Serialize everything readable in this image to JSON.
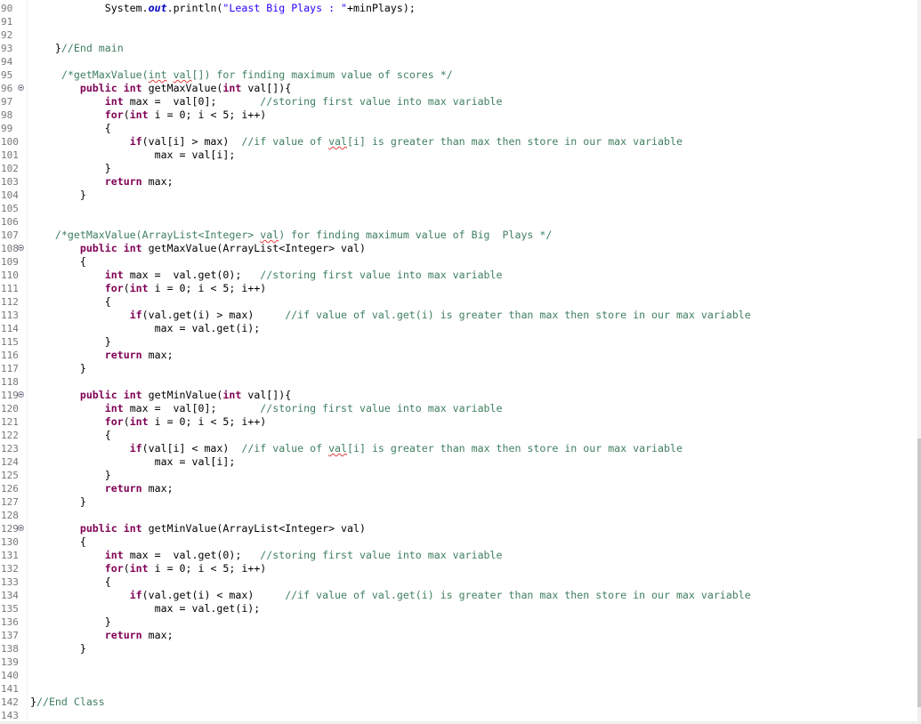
{
  "editor": {
    "language": "java",
    "colors": {
      "keyword": "#7f0055",
      "comment": "#3f7f5f",
      "string": "#2a00ff",
      "static_field": "#0000c0",
      "line_number": "#787878"
    },
    "lines": [
      {
        "n": "90",
        "fold": false,
        "tokens": [
          [
            "",
            "            "
          ],
          [
            "",
            "System."
          ],
          [
            "fld",
            "out"
          ],
          [
            "",
            ".println("
          ],
          [
            "str",
            "\"Least Big Plays : \""
          ],
          [
            "",
            "+minPlays);"
          ]
        ]
      },
      {
        "n": "91",
        "fold": false,
        "tokens": []
      },
      {
        "n": "92",
        "fold": false,
        "tokens": []
      },
      {
        "n": "93",
        "fold": false,
        "tokens": [
          [
            "",
            "    }"
          ],
          [
            "cm",
            "//End main"
          ]
        ]
      },
      {
        "n": "94",
        "fold": false,
        "tokens": []
      },
      {
        "n": "95",
        "fold": false,
        "tokens": [
          [
            "cm",
            "     /*getMaxValue("
          ],
          [
            "cm sq",
            "int"
          ],
          [
            "cm",
            " "
          ],
          [
            "cm sq",
            "val"
          ],
          [
            "cm",
            "[]) for finding maximum value of scores */"
          ]
        ]
      },
      {
        "n": "96",
        "fold": true,
        "tokens": [
          [
            "",
            "        "
          ],
          [
            "kw",
            "public"
          ],
          [
            "",
            " "
          ],
          [
            "kw",
            "int"
          ],
          [
            "",
            " getMaxValue("
          ],
          [
            "kw",
            "int"
          ],
          [
            "",
            " val[]){"
          ]
        ]
      },
      {
        "n": "97",
        "fold": false,
        "tokens": [
          [
            "",
            "            "
          ],
          [
            "kw",
            "int"
          ],
          [
            "",
            " max =  val[0];       "
          ],
          [
            "cm",
            "//storing first value into max variable"
          ]
        ]
      },
      {
        "n": "98",
        "fold": false,
        "tokens": [
          [
            "",
            "            "
          ],
          [
            "kw",
            "for"
          ],
          [
            "",
            "("
          ],
          [
            "kw",
            "int"
          ],
          [
            "",
            " i = 0; i < 5; i++)"
          ]
        ]
      },
      {
        "n": "99",
        "fold": false,
        "tokens": [
          [
            "",
            "            {"
          ]
        ]
      },
      {
        "n": "100",
        "fold": false,
        "tokens": [
          [
            "",
            "                "
          ],
          [
            "kw",
            "if"
          ],
          [
            "",
            "(val[i] > max)  "
          ],
          [
            "cm",
            "//if value of "
          ],
          [
            "cm sq",
            "val"
          ],
          [
            "cm",
            "[i] is greater than max then store in our max variable"
          ]
        ]
      },
      {
        "n": "101",
        "fold": false,
        "tokens": [
          [
            "",
            "                    max = val[i];"
          ]
        ]
      },
      {
        "n": "102",
        "fold": false,
        "tokens": [
          [
            "",
            "            }"
          ]
        ]
      },
      {
        "n": "103",
        "fold": false,
        "tokens": [
          [
            "",
            "            "
          ],
          [
            "kw",
            "return"
          ],
          [
            "",
            " max;"
          ]
        ]
      },
      {
        "n": "104",
        "fold": false,
        "tokens": [
          [
            "",
            "        }"
          ]
        ]
      },
      {
        "n": "105",
        "fold": false,
        "tokens": []
      },
      {
        "n": "106",
        "fold": false,
        "tokens": []
      },
      {
        "n": "107",
        "fold": false,
        "tokens": [
          [
            "cm",
            "    /*getMaxValue(ArrayList<Integer> "
          ],
          [
            "cm sq",
            "val"
          ],
          [
            "cm",
            ") for finding maximum value of Big  Plays */"
          ]
        ]
      },
      {
        "n": "108",
        "fold": true,
        "tokens": [
          [
            "",
            "        "
          ],
          [
            "kw",
            "public"
          ],
          [
            "",
            " "
          ],
          [
            "kw",
            "int"
          ],
          [
            "",
            " getMaxValue(ArrayList<Integer> val)"
          ]
        ]
      },
      {
        "n": "109",
        "fold": false,
        "tokens": [
          [
            "",
            "        {"
          ]
        ]
      },
      {
        "n": "110",
        "fold": false,
        "tokens": [
          [
            "",
            "            "
          ],
          [
            "kw",
            "int"
          ],
          [
            "",
            " max =  val.get(0);   "
          ],
          [
            "cm",
            "//storing first value into max variable"
          ]
        ]
      },
      {
        "n": "111",
        "fold": false,
        "tokens": [
          [
            "",
            "            "
          ],
          [
            "kw",
            "for"
          ],
          [
            "",
            "("
          ],
          [
            "kw",
            "int"
          ],
          [
            "",
            " i = 0; i < 5; i++)"
          ]
        ]
      },
      {
        "n": "112",
        "fold": false,
        "tokens": [
          [
            "",
            "            {"
          ]
        ]
      },
      {
        "n": "113",
        "fold": false,
        "tokens": [
          [
            "",
            "                "
          ],
          [
            "kw",
            "if"
          ],
          [
            "",
            "(val.get(i) > max)     "
          ],
          [
            "cm",
            "//if value of val.get(i) is greater than max then store in our max variable"
          ]
        ]
      },
      {
        "n": "114",
        "fold": false,
        "tokens": [
          [
            "",
            "                    max = val.get(i);"
          ]
        ]
      },
      {
        "n": "115",
        "fold": false,
        "tokens": [
          [
            "",
            "            }"
          ]
        ]
      },
      {
        "n": "116",
        "fold": false,
        "tokens": [
          [
            "",
            "            "
          ],
          [
            "kw",
            "return"
          ],
          [
            "",
            " max;"
          ]
        ]
      },
      {
        "n": "117",
        "fold": false,
        "tokens": [
          [
            "",
            "        }"
          ]
        ]
      },
      {
        "n": "118",
        "fold": false,
        "tokens": []
      },
      {
        "n": "119",
        "fold": true,
        "tokens": [
          [
            "",
            "        "
          ],
          [
            "kw",
            "public"
          ],
          [
            "",
            " "
          ],
          [
            "kw",
            "int"
          ],
          [
            "",
            " getMinValue("
          ],
          [
            "kw",
            "int"
          ],
          [
            "",
            " val[]){"
          ]
        ]
      },
      {
        "n": "120",
        "fold": false,
        "tokens": [
          [
            "",
            "            "
          ],
          [
            "kw",
            "int"
          ],
          [
            "",
            " max =  val[0];       "
          ],
          [
            "cm",
            "//storing first value into max variable"
          ]
        ]
      },
      {
        "n": "121",
        "fold": false,
        "tokens": [
          [
            "",
            "            "
          ],
          [
            "kw",
            "for"
          ],
          [
            "",
            "("
          ],
          [
            "kw",
            "int"
          ],
          [
            "",
            " i = 0; i < 5; i++)"
          ]
        ]
      },
      {
        "n": "122",
        "fold": false,
        "tokens": [
          [
            "",
            "            {"
          ]
        ]
      },
      {
        "n": "123",
        "fold": false,
        "tokens": [
          [
            "",
            "                "
          ],
          [
            "kw",
            "if"
          ],
          [
            "",
            "(val[i] < max)  "
          ],
          [
            "cm",
            "//if value of "
          ],
          [
            "cm sq",
            "val"
          ],
          [
            "cm",
            "[i] is greater than max then store in our max variable"
          ]
        ]
      },
      {
        "n": "124",
        "fold": false,
        "tokens": [
          [
            "",
            "                    max = val[i];"
          ]
        ]
      },
      {
        "n": "125",
        "fold": false,
        "tokens": [
          [
            "",
            "            }"
          ]
        ]
      },
      {
        "n": "126",
        "fold": false,
        "tokens": [
          [
            "",
            "            "
          ],
          [
            "kw",
            "return"
          ],
          [
            "",
            " max;"
          ]
        ]
      },
      {
        "n": "127",
        "fold": false,
        "tokens": [
          [
            "",
            "        }"
          ]
        ]
      },
      {
        "n": "128",
        "fold": false,
        "tokens": []
      },
      {
        "n": "129",
        "fold": true,
        "tokens": [
          [
            "",
            "        "
          ],
          [
            "kw",
            "public"
          ],
          [
            "",
            " "
          ],
          [
            "kw",
            "int"
          ],
          [
            "",
            " getMinValue(ArrayList<Integer> val)"
          ]
        ]
      },
      {
        "n": "130",
        "fold": false,
        "tokens": [
          [
            "",
            "        {"
          ]
        ]
      },
      {
        "n": "131",
        "fold": false,
        "tokens": [
          [
            "",
            "            "
          ],
          [
            "kw",
            "int"
          ],
          [
            "",
            " max =  val.get(0);   "
          ],
          [
            "cm",
            "//storing first value into max variable"
          ]
        ]
      },
      {
        "n": "132",
        "fold": false,
        "tokens": [
          [
            "",
            "            "
          ],
          [
            "kw",
            "for"
          ],
          [
            "",
            "("
          ],
          [
            "kw",
            "int"
          ],
          [
            "",
            " i = 0; i < 5; i++)"
          ]
        ]
      },
      {
        "n": "133",
        "fold": false,
        "tokens": [
          [
            "",
            "            {"
          ]
        ]
      },
      {
        "n": "134",
        "fold": false,
        "tokens": [
          [
            "",
            "                "
          ],
          [
            "kw",
            "if"
          ],
          [
            "",
            "(val.get(i) < max)     "
          ],
          [
            "cm",
            "//if value of val.get(i) is greater than max then store in our max variable"
          ]
        ]
      },
      {
        "n": "135",
        "fold": false,
        "tokens": [
          [
            "",
            "                    max = val.get(i);"
          ]
        ]
      },
      {
        "n": "136",
        "fold": false,
        "tokens": [
          [
            "",
            "            }"
          ]
        ]
      },
      {
        "n": "137",
        "fold": false,
        "tokens": [
          [
            "",
            "            "
          ],
          [
            "kw",
            "return"
          ],
          [
            "",
            " max;"
          ]
        ]
      },
      {
        "n": "138",
        "fold": false,
        "tokens": [
          [
            "",
            "        }"
          ]
        ]
      },
      {
        "n": "139",
        "fold": false,
        "tokens": []
      },
      {
        "n": "140",
        "fold": false,
        "tokens": []
      },
      {
        "n": "141",
        "fold": false,
        "tokens": []
      },
      {
        "n": "142",
        "fold": false,
        "tokens": [
          [
            "",
            "}"
          ],
          [
            "cm",
            "//End Class"
          ]
        ]
      },
      {
        "n": "143",
        "fold": false,
        "tokens": []
      }
    ]
  },
  "scrollbar": {
    "position_fraction": 0.61,
    "visible_fraction": 0.37
  }
}
